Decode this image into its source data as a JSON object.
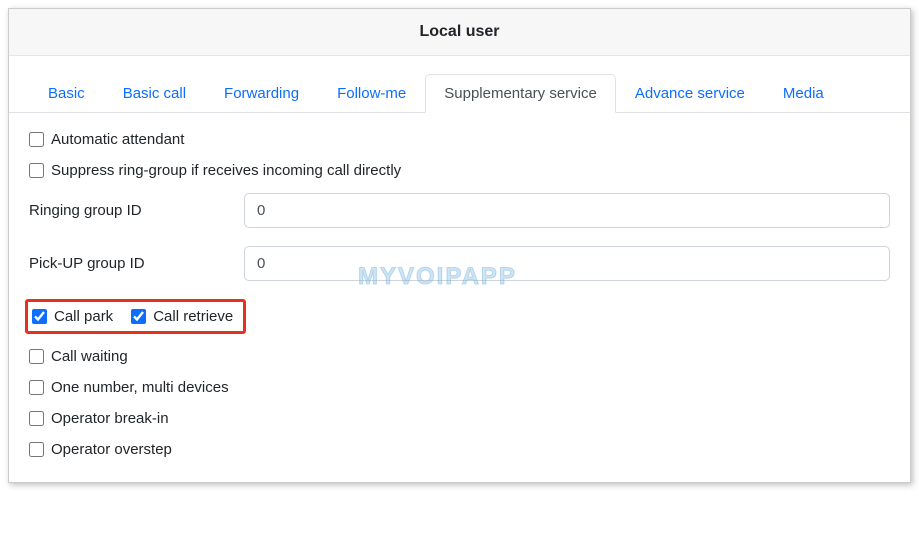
{
  "header": {
    "title": "Local user"
  },
  "tabs": {
    "basic": "Basic",
    "basic_call": "Basic call",
    "forwarding": "Forwarding",
    "follow_me": "Follow-me",
    "supplementary": "Supplementary service",
    "advance": "Advance service",
    "media": "Media"
  },
  "options": {
    "auto_attendant": {
      "label": "Automatic attendant",
      "checked": false
    },
    "suppress_ring_group": {
      "label": "Suppress ring-group if receives incoming call directly",
      "checked": false
    },
    "ringing_group_id": {
      "label": "Ringing group ID",
      "value": "0"
    },
    "pickup_group_id": {
      "label": "Pick-UP group ID",
      "value": "0"
    },
    "call_park": {
      "label": "Call park",
      "checked": true
    },
    "call_retrieve": {
      "label": "Call retrieve",
      "checked": true
    },
    "call_waiting": {
      "label": "Call waiting",
      "checked": false
    },
    "one_number": {
      "label": "One number, multi devices",
      "checked": false
    },
    "operator_breakin": {
      "label": "Operator break-in",
      "checked": false
    },
    "operator_overstep": {
      "label": "Operator overstep",
      "checked": false
    }
  },
  "watermark": "MYVOIPAPP"
}
